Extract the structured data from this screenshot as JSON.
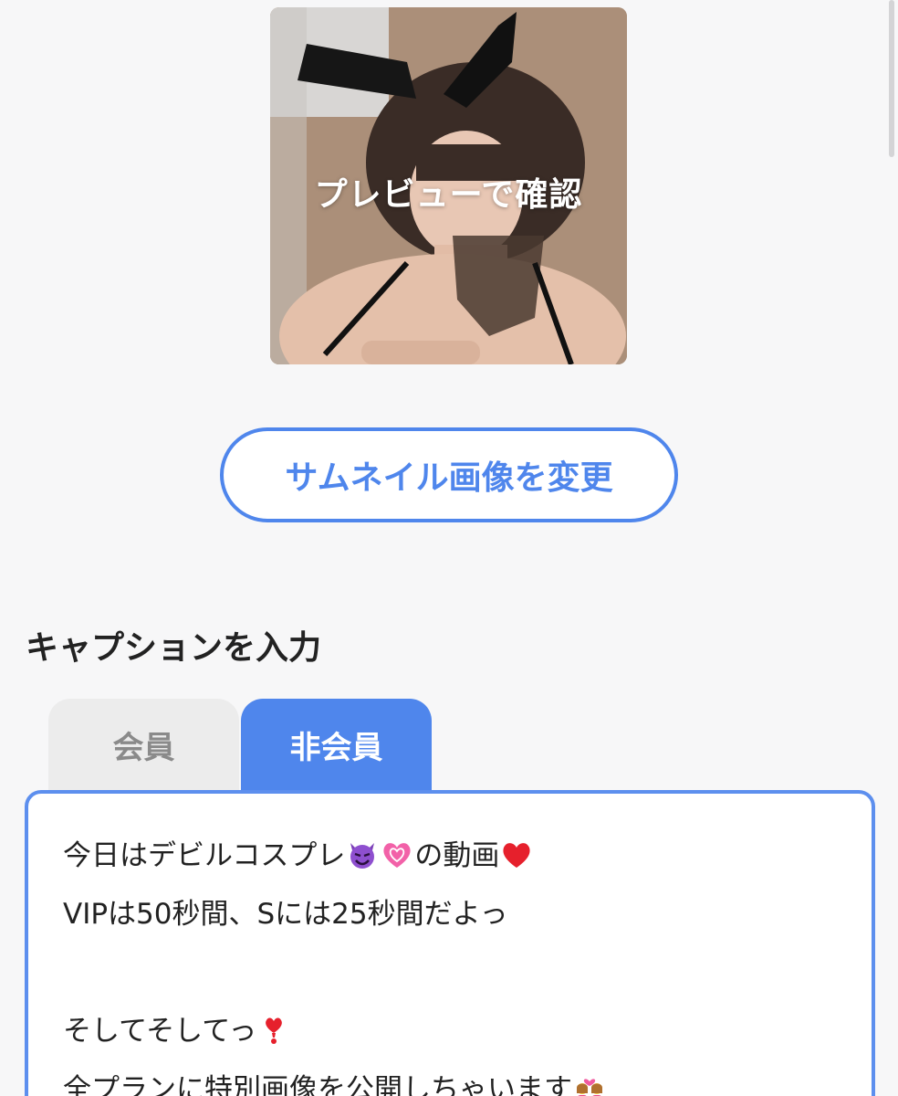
{
  "thumbnail": {
    "preview_label": "プレビューで確認"
  },
  "change_thumbnail_button": "サムネイル画像を変更",
  "caption_section": {
    "title": "キャプションを入力",
    "tabs": [
      {
        "label": "会員",
        "active": false
      },
      {
        "label": "非会員",
        "active": true
      }
    ],
    "caption_lines": [
      {
        "text": "今日はデビルコスプレ",
        "emojis": [
          "smiling-devil-emoji",
          "growing-heart-emoji"
        ],
        "after": "の動画",
        "trailing_emoji": "red-heart-emoji"
      },
      {
        "text": "VIPは50秒間、Sには25秒間だよっ"
      },
      {
        "text": ""
      },
      {
        "text": "そしてそしてっ",
        "trailing_emoji": "exclamation-heart-emoji"
      },
      {
        "text": "全プランに特別画像を公開しちゃいます",
        "trailing_emoji": "couple-with-heart-emoji"
      }
    ]
  },
  "colors": {
    "accent": "#4f86ec",
    "background": "#f7f7f8",
    "inactive_tab": "#ececec",
    "text": "#222222"
  }
}
